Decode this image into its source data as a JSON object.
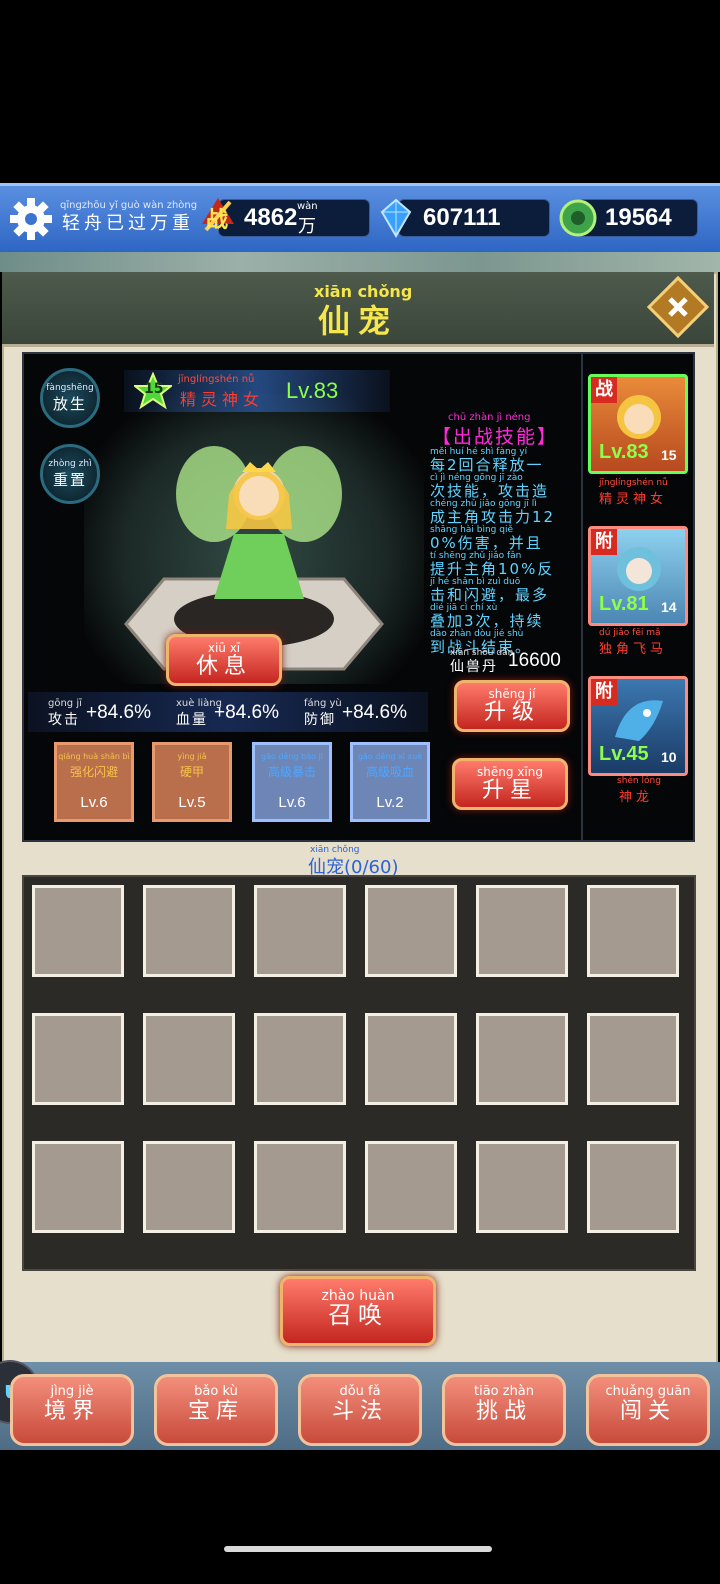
{
  "topbar": {
    "player_name_pinyin": "qīngzhōu yǐ guò wàn zhòng",
    "player_name": "轻舟已过万重",
    "power_value": "4862",
    "power_unit_pinyin": "wàn",
    "power_unit": "万",
    "power_icon_char": "战",
    "gems": "607111",
    "jade": "19564"
  },
  "panel": {
    "title_pinyin": "xiān chǒng",
    "title": "仙宠"
  },
  "hero": {
    "release_pinyin": "fàngshēng",
    "release": "放生",
    "reset_pinyin": "zhòng zhì",
    "reset": "重置",
    "star": "15",
    "name_pinyin": "jīnglíngshén nǚ",
    "name": "精灵神女",
    "level": "Lv.83",
    "rest_pinyin": "xiū  xī",
    "rest": "休息",
    "skill_title_pinyin": "chū zhàn  jì  néng",
    "skill_title": "【出战技能】",
    "skill_desc_pinyin_1": "měi    huí  hé  shì fàng  yí",
    "skill_desc_1": "每2回合释放一",
    "skill_desc_pinyin_2": "cì   jì  néng    gōng  jī  zào",
    "skill_desc_2": "次技能，攻击造",
    "skill_desc_pinyin_3": "chéng zhǔ jiǎo gōng  jī   lì",
    "skill_desc_3": "成主角攻击力12",
    "skill_desc_pinyin_4": "shāng hài      bìng qiě",
    "skill_desc_4": "0%伤害，并且",
    "skill_desc_pinyin_5": "tí  shēng zhǔ jiǎo       fǎn",
    "skill_desc_5": "提升主角10%反",
    "skill_desc_pinyin_6": "jī  hé shǎn bì      zuì duō",
    "skill_desc_6": "击和闪避，最多",
    "skill_desc_pinyin_7": "dié  jiā    cì     chí  xù",
    "skill_desc_7": "叠加3次，持续",
    "skill_desc_pinyin_8": "dào zhàn dòu  jié  shù",
    "skill_desc_8": "到战斗结束。",
    "pill_pinyin": "xiān shòu dān",
    "pill_label": "仙兽丹",
    "pill_value": "16600",
    "upgrade_pinyin": "shēng  jí",
    "upgrade": "升级",
    "starup_pinyin": "shēng xīng",
    "starup": "升星",
    "stats": [
      {
        "pinyin": "gōng  jī",
        "label": "攻击",
        "value": "+84.6%"
      },
      {
        "pinyin": "xuè liàng",
        "label": "血量",
        "value": "+84.6%"
      },
      {
        "pinyin": "fáng  yù",
        "label": "防御",
        "value": "+84.6%"
      }
    ],
    "skills": [
      {
        "pinyin": "qiáng huà shǎn  bì",
        "label": "强化闪避",
        "level": "Lv.6",
        "color": "#f7c24a"
      },
      {
        "pinyin": "yìng  jiǎ",
        "label": "硬甲",
        "level": "Lv.5",
        "color": "#f7c24a"
      },
      {
        "pinyin": "gāo děng bào jī",
        "label": "高级暴击",
        "level": "Lv.6",
        "color": "#4fa6ff"
      },
      {
        "pinyin": "gāo děng xī xuè",
        "label": "高级吸血",
        "level": "Lv.2",
        "color": "#4fa6ff"
      }
    ]
  },
  "pets": [
    {
      "tag": "战",
      "level": "Lv.83",
      "star": "15",
      "name_pinyin": "jīnglíngshén nǚ",
      "name": "精灵神女",
      "selected": true
    },
    {
      "tag": "附",
      "level": "Lv.81",
      "star": "14",
      "name_pinyin": "dú  jiǎo  fēi  mǎ",
      "name": "独角飞马",
      "selected": false
    },
    {
      "tag": "附",
      "level": "Lv.45",
      "star": "10",
      "name_pinyin": "shén lóng",
      "name": "神龙",
      "selected": false
    }
  ],
  "inventory": {
    "title_pinyin": "xiān chǒng",
    "title": "仙宠(0/60)"
  },
  "summon": {
    "pinyin": "zhào huàn",
    "label": "召唤"
  },
  "nav": [
    {
      "pinyin": "jìng  jiè",
      "label": "境界"
    },
    {
      "pinyin": "bǎo  kù",
      "label": "宝库"
    },
    {
      "pinyin": "dǒu  fǎ",
      "label": "斗法"
    },
    {
      "pinyin": "tiāo zhàn",
      "label": "挑战"
    },
    {
      "pinyin": "chuǎng guān",
      "label": "闯关"
    }
  ],
  "float_button": "up",
  "colors": {
    "accent_gold": "#f4e64b",
    "level_green": "#8cff4a",
    "skill_magenta": "#ff2bd8",
    "skill_cyan": "#5fd4ff"
  }
}
